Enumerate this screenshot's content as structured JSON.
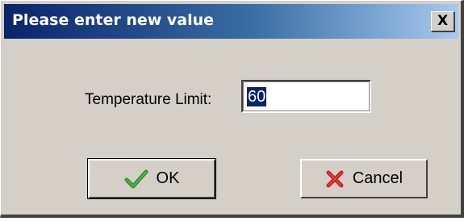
{
  "dialog": {
    "title": "Please enter new value",
    "close_label": "X",
    "field_label": "Temperature Limit:",
    "field_value": "60",
    "ok_label": "OK",
    "cancel_label": "Cancel"
  },
  "icons": {
    "ok": "checkmark-icon",
    "cancel": "red-x-icon",
    "close": "close-icon"
  },
  "colors": {
    "titlebar_start": "#0a246a",
    "titlebar_end": "#a6caf0",
    "face": "#d4d0c8",
    "check_green": "#2e8b2e",
    "cancel_red": "#cc1f1f",
    "selection": "#0a246a"
  }
}
